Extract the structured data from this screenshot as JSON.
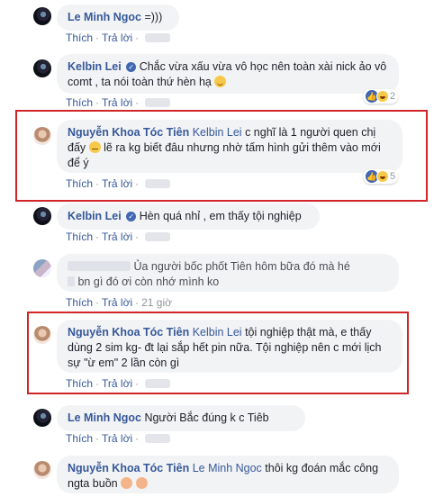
{
  "actions": {
    "like": "Thích",
    "reply": "Trả lời",
    "separator": "·"
  },
  "comments": [
    {
      "name": "Le Minh Ngoc",
      "text": "=)))"
    },
    {
      "name": "Kelbin Lei",
      "verified": "✓",
      "text": "Chắc vừa xấu vừa vô học nên toàn xài nick ảo vô comt , ta nói toàn thứ hèn hạ",
      "reaction_count": "2"
    },
    {
      "name": "Nguyễn Khoa Tóc Tiên",
      "tag": "Kelbin Lei",
      "text_a": "c nghĩ là 1 người quen chị đấy",
      "text_b": "lẽ ra kg biết đâu nhưng nhờ tấm hình gửi thêm vào mới để ý",
      "reaction_count": "5"
    },
    {
      "name": "Kelbin Lei",
      "verified": "✓",
      "text": "Hèn quá nhỉ , em thấy tội nghiệp"
    },
    {
      "text": "Ủa người bốc phốt Tiên hôm bữa đó mà hé",
      "text_b": "bn gì đó ơi còn nhớ mình ko",
      "time": "21 giờ"
    },
    {
      "name": "Nguyễn Khoa Tóc Tiên",
      "tag": "Kelbin Lei",
      "text": "tội nghiệp thật mà, e thấy dùng 2 sim kg- đt lại sắp hết pin nữa. Tội nghiệp nên c mới lịch sự \"ừ em\" 2 lần còn gì"
    },
    {
      "name": "Le Minh Ngoc",
      "text": "Người Bắc đúng k c Tiêb"
    },
    {
      "name": "Nguyễn Khoa Tóc Tiên",
      "tag": "Le Minh Ngoc",
      "text": "thôi kg đoán mắc công ngta buồn"
    }
  ],
  "colors": {
    "link": "#365899",
    "highlight": "#d0262a",
    "bubble": "#f2f3f5"
  }
}
